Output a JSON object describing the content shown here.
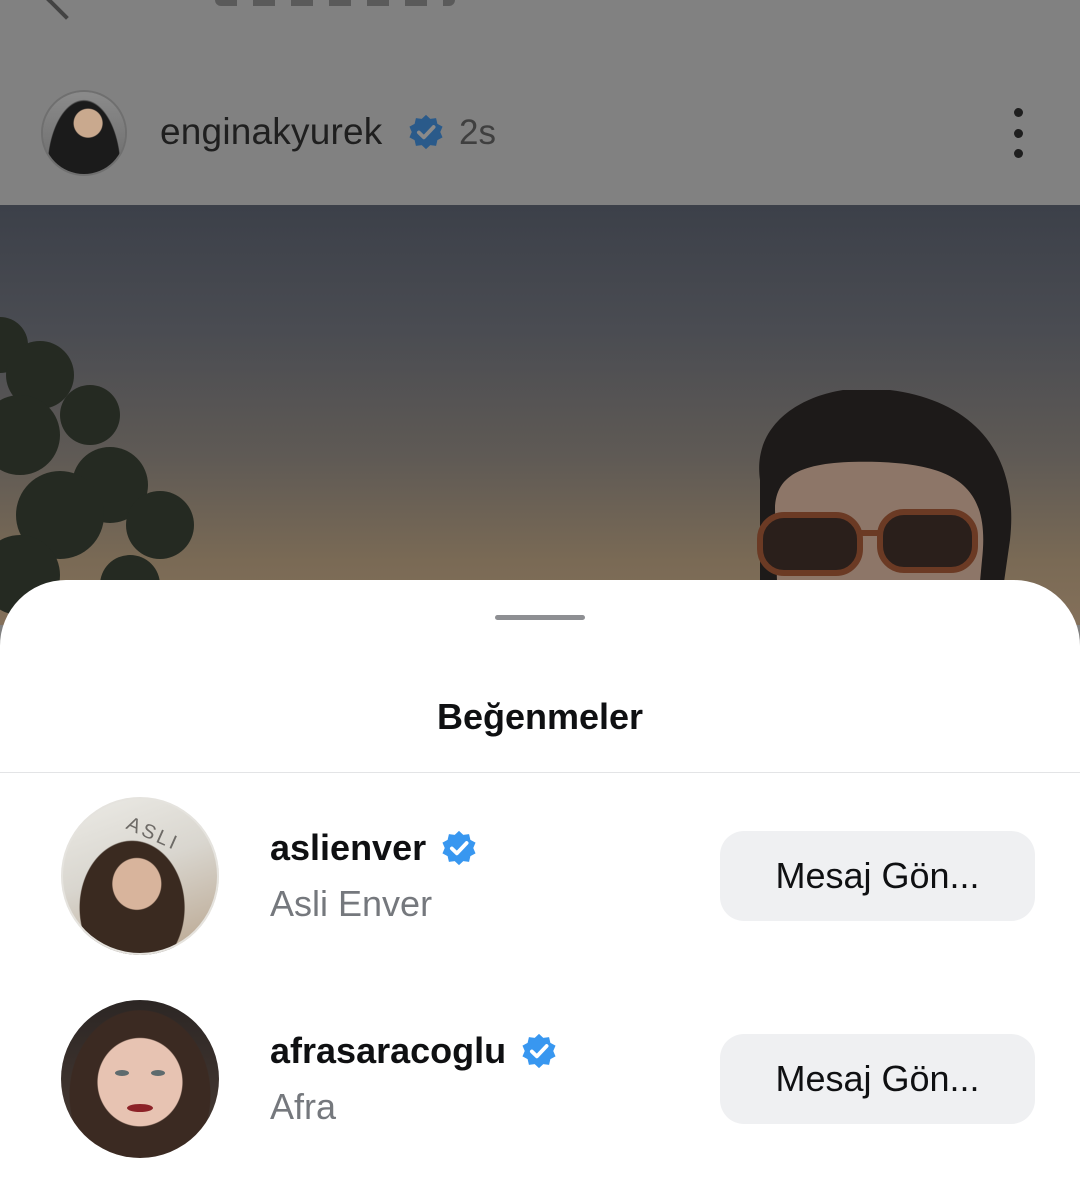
{
  "post": {
    "username": "enginakyurek",
    "time": "2s",
    "verified": true,
    "more_icon": "more-vertical-icon"
  },
  "likes_sheet": {
    "title": "Beğenmeler",
    "users": [
      {
        "username": "aslienver",
        "full_name": "Asli Enver",
        "verified": true,
        "avatar_text": "ASLI",
        "button_label": "Mesaj Gön..."
      },
      {
        "username": "afrasaracoglu",
        "full_name": "Afra",
        "verified": true,
        "button_label": "Mesaj Gön..."
      }
    ]
  },
  "colors": {
    "verified_badge": "#3897f0",
    "button_bg": "#eff0f2",
    "secondary_text": "#75787d",
    "overlay": "#808080"
  }
}
